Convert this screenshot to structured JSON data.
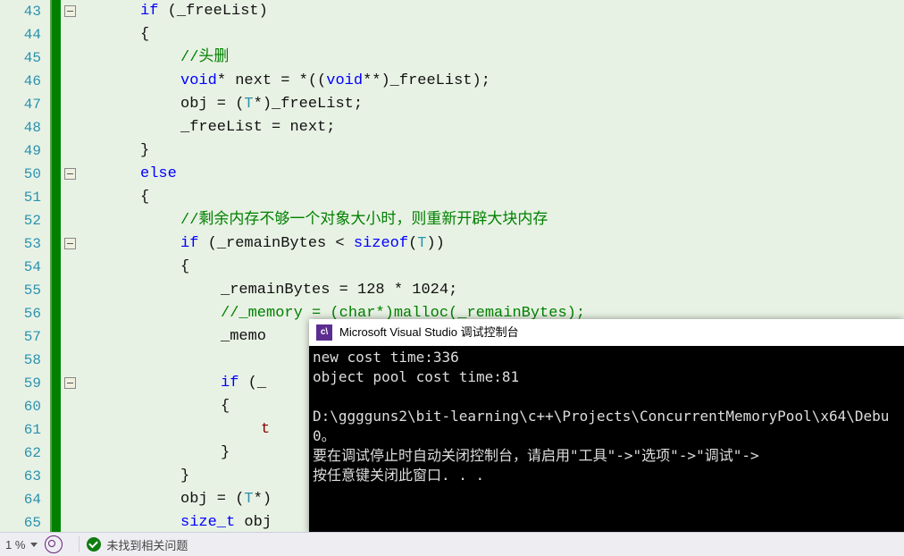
{
  "editor": {
    "first_line_no": 43,
    "lines": [
      [
        [
          "kw",
          "if"
        ],
        [
          "punct",
          " ("
        ],
        [
          "ident",
          "_freeList"
        ],
        [
          "punct",
          ")"
        ]
      ],
      [
        [
          "punct",
          "{"
        ]
      ],
      [
        [
          "comment",
          "//头删"
        ]
      ],
      [
        [
          "kw",
          "void"
        ],
        [
          "punct",
          "* "
        ],
        [
          "ident",
          "next"
        ],
        [
          "punct",
          " = *(("
        ],
        [
          "kw",
          "void"
        ],
        [
          "punct",
          "**)"
        ],
        [
          "ident",
          "_freeList"
        ],
        [
          "punct",
          ");"
        ]
      ],
      [
        [
          "ident",
          "obj"
        ],
        [
          "punct",
          " = ("
        ],
        [
          "type",
          "T"
        ],
        [
          "punct",
          "*)"
        ],
        [
          "ident",
          "_freeList"
        ],
        [
          "punct",
          ";"
        ]
      ],
      [
        [
          "ident",
          "_freeList"
        ],
        [
          "punct",
          " = "
        ],
        [
          "ident",
          "next"
        ],
        [
          "punct",
          ";"
        ]
      ],
      [
        [
          "punct",
          "}"
        ]
      ],
      [
        [
          "kw",
          "else"
        ]
      ],
      [
        [
          "punct",
          "{"
        ]
      ],
      [
        [
          "comment",
          "//剩余内存不够一个对象大小时，则重新开辟大块内存"
        ]
      ],
      [
        [
          "kw",
          "if"
        ],
        [
          "punct",
          " ("
        ],
        [
          "ident",
          "_remainBytes"
        ],
        [
          "punct",
          " < "
        ],
        [
          "kw",
          "sizeof"
        ],
        [
          "punct",
          "("
        ],
        [
          "type",
          "T"
        ],
        [
          "punct",
          "))"
        ]
      ],
      [
        [
          "punct",
          "{"
        ]
      ],
      [
        [
          "ident",
          "_remainBytes"
        ],
        [
          "punct",
          " = "
        ],
        [
          "num",
          "128"
        ],
        [
          "punct",
          " * "
        ],
        [
          "num",
          "1024"
        ],
        [
          "punct",
          ";"
        ]
      ],
      [
        [
          "comment",
          "//_memory = (char*)malloc(_remainBytes);"
        ]
      ],
      [
        [
          "ident",
          "_memo"
        ]
      ],
      [],
      [
        [
          "kw",
          "if"
        ],
        [
          "punct",
          " ("
        ],
        [
          "ident",
          "_"
        ]
      ],
      [
        [
          "punct",
          "{"
        ]
      ],
      [
        [
          "hotword",
          "t"
        ]
      ],
      [
        [
          "punct",
          "}"
        ]
      ],
      [
        [
          "punct",
          "}"
        ]
      ],
      [
        [
          "ident",
          "obj"
        ],
        [
          "punct",
          " = ("
        ],
        [
          "type",
          "T"
        ],
        [
          "punct",
          "*)"
        ]
      ],
      [
        [
          "kw",
          "size_t"
        ],
        [
          "punct",
          " "
        ],
        [
          "ident",
          "obj"
        ]
      ]
    ],
    "indents": [
      5,
      5,
      6,
      6,
      6,
      6,
      5,
      5,
      5,
      6,
      6,
      6,
      7,
      7,
      7,
      7,
      7,
      7,
      8,
      7,
      6,
      6,
      6
    ],
    "fold_rows": {
      "1": "minus",
      "8": "minus",
      "11": "minus",
      "17": "minus"
    }
  },
  "console": {
    "title": "Microsoft Visual Studio 调试控制台",
    "lines": [
      "new cost time:336",
      "object pool cost time:81",
      "",
      "D:\\gggguns2\\bit-learning\\c++\\Projects\\ConcurrentMemoryPool\\x64\\Debu",
      "0。",
      "要在调试停止时自动关闭控制台，请启用\"工具\"->\"选项\"->\"调试\"->",
      "按任意键关闭此窗口. . ."
    ]
  },
  "statusbar": {
    "zoom": "1 %",
    "issues_text": "未找到相关问题"
  }
}
